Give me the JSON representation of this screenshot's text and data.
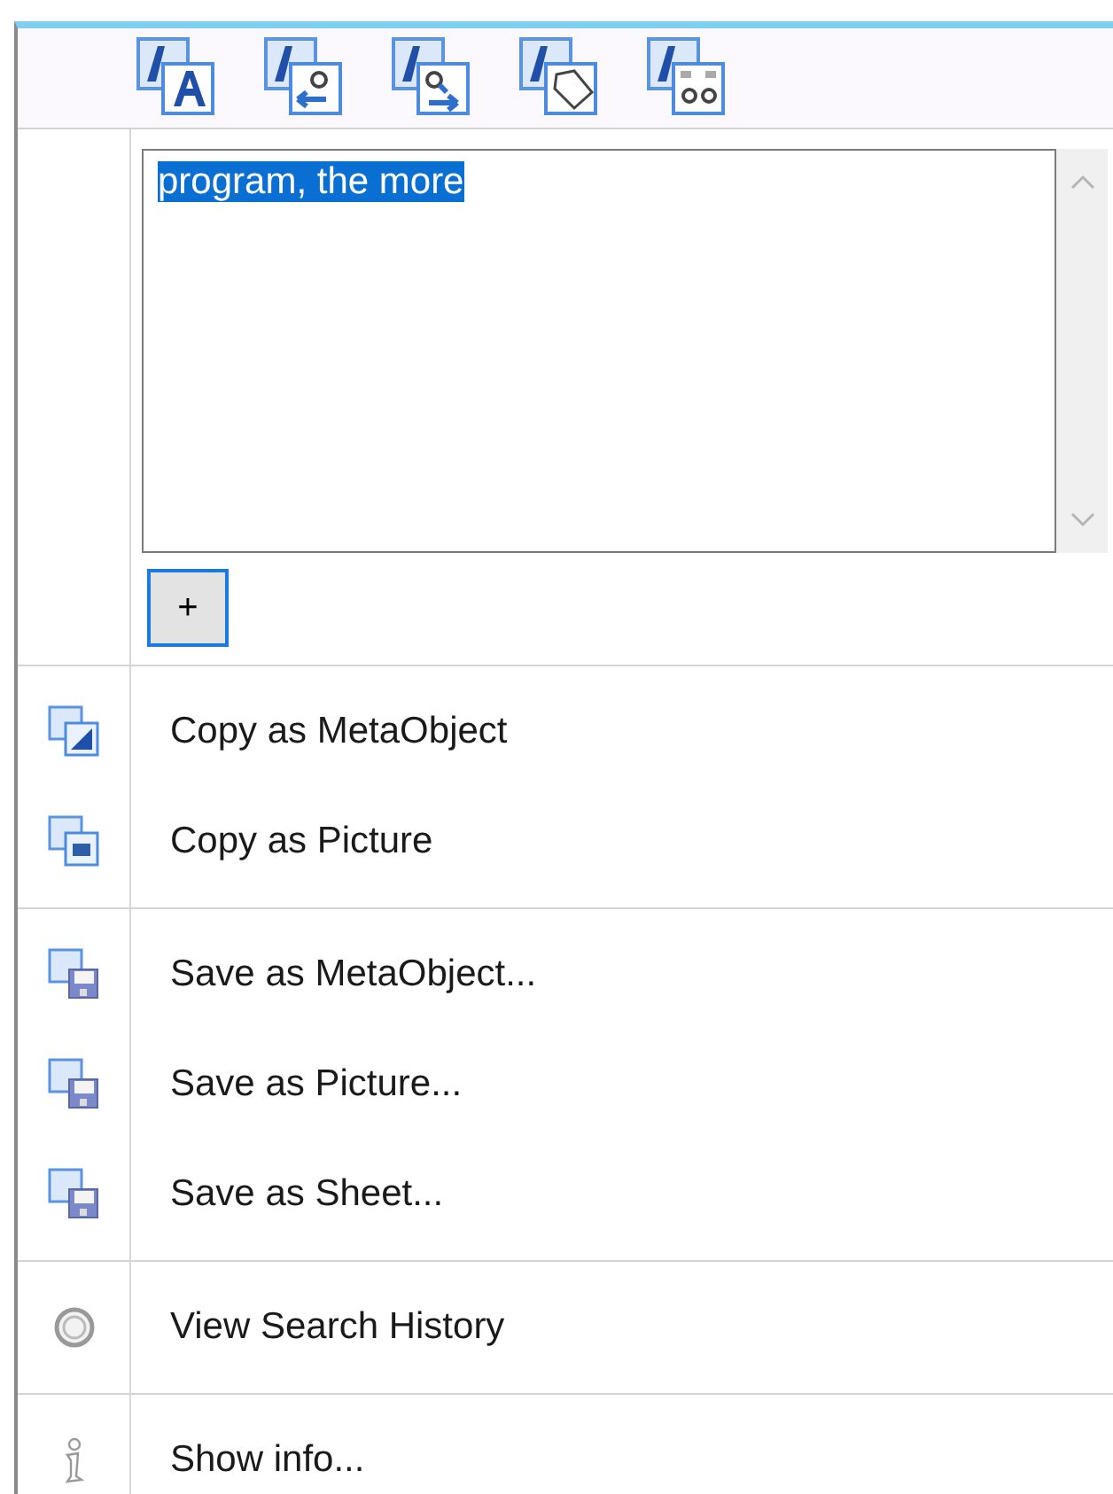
{
  "text_box": {
    "value": "program, the more",
    "selected": true
  },
  "add_button": {
    "label": "+"
  },
  "menu_groups": [
    [
      {
        "label": "Copy as MetaObject"
      },
      {
        "label": "Copy as Picture"
      }
    ],
    [
      {
        "label": "Save as MetaObject..."
      },
      {
        "label": "Save as Picture..."
      },
      {
        "label": "Save as Sheet..."
      }
    ],
    [
      {
        "label": "View Search History"
      }
    ],
    [
      {
        "label": "Show info..."
      }
    ]
  ]
}
